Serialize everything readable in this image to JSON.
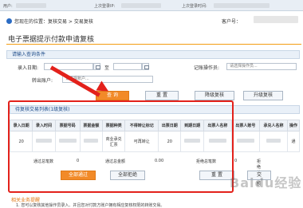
{
  "topbar": {
    "user_label": "用户:",
    "last_login_label": "上次登录IP:",
    "last_time_label": "上次登录时间:"
  },
  "breadcrumb": {
    "text": "您现在的位置：复核交易 > 交易复核"
  },
  "customer": {
    "label": "客户号："
  },
  "page_title": "电子票据提示付款申请复核",
  "query": {
    "section_label": "请输入查询条件",
    "date_label": "录入日期:",
    "to_label": "至",
    "operator_label": "记账操作员:",
    "operator_placeholder": "请选择操作员...",
    "account_label": "转出账户:",
    "account_placeholder": "请选择账户...",
    "query_button": "查 询",
    "reset_button": "重 置",
    "level1_button": "降级复核",
    "level2_button": "升级复核"
  },
  "list": {
    "section_label": "待复核交易列表(1级复核)",
    "columns": [
      "录入日期",
      "录入时间",
      "票据号码",
      "票据金额",
      "票据种类",
      "不得转让标记",
      "出票日期",
      "到期日期",
      "出票人名称",
      "出票人账号",
      "承兑人名称",
      "操作"
    ],
    "row": {
      "date": "20",
      "type_line1": "商业承兑",
      "type_line2": "汇票",
      "transfer_flag": "可再转让",
      "issue_date": "20",
      "action": "通"
    }
  },
  "summary": {
    "approved_label": "通过总笔数",
    "approved_value": "0",
    "approved_amount_label": "通过总金额",
    "approved_amount": "0.00",
    "rejected_label": "拒绝总笔数",
    "rejected_value": "0",
    "rejected_amount_label": "拒绝总金额"
  },
  "actions": {
    "pass_all": "全部通过",
    "reject_all": "全部拒绝",
    "reset": "重 置",
    "submit": "交"
  },
  "hint": {
    "title": "相关业务提醒",
    "note": "1. 您可以复核其他操作员录入、并且您对付款方账户拥有相应复核权限的转账交易。"
  },
  "watermark": "Baidu经验"
}
